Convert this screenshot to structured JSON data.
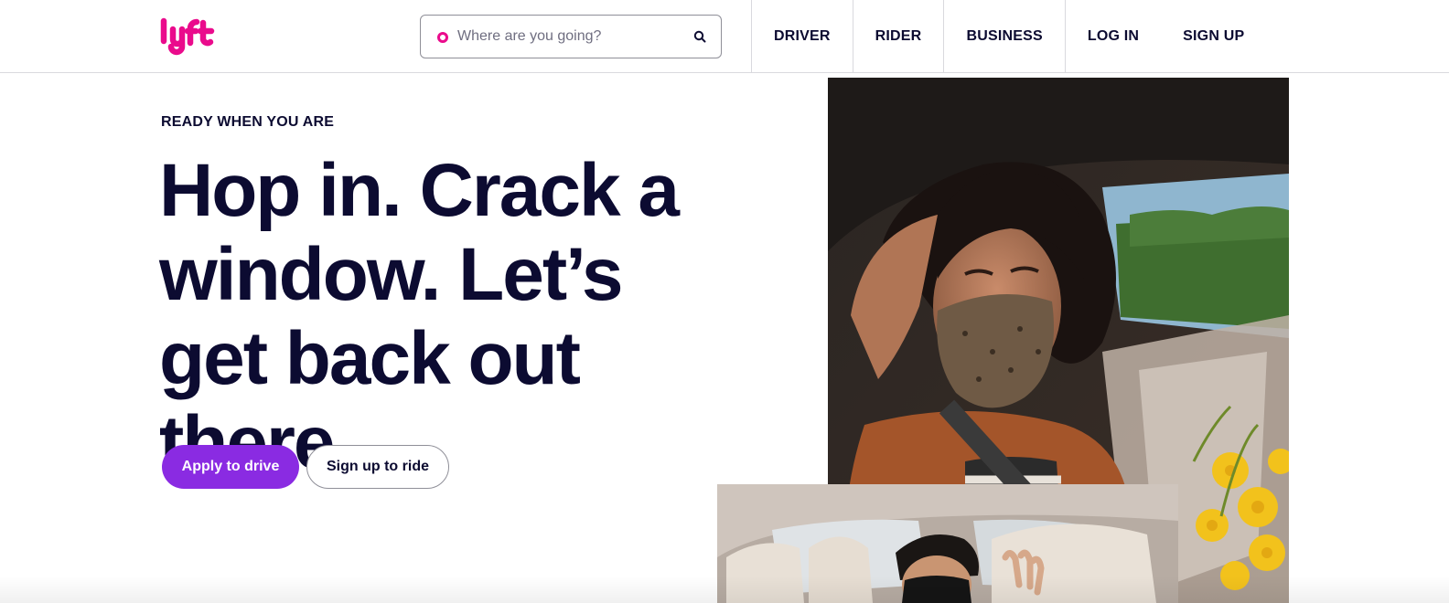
{
  "header": {
    "logo_alt": "lyft",
    "brand_color": "#ea0b8c",
    "search": {
      "placeholder": "Where are you going?",
      "value": ""
    },
    "nav": [
      {
        "label": "DRIVER"
      },
      {
        "label": "RIDER"
      },
      {
        "label": "BUSINESS"
      },
      {
        "label": "LOG IN"
      },
      {
        "label": "SIGN UP"
      }
    ]
  },
  "hero": {
    "kicker": "READY WHEN YOU ARE",
    "headline": "Hop in. Crack a window. Let’s get back out there.",
    "primary_button": "Apply to drive",
    "secondary_button": "Sign up to ride",
    "accent_color": "#8a2be2",
    "text_color": "#0c0b31"
  },
  "icons": {
    "logo": "lyft-logo-icon",
    "search_origin": "origin-dot-icon",
    "search": "search-icon"
  }
}
